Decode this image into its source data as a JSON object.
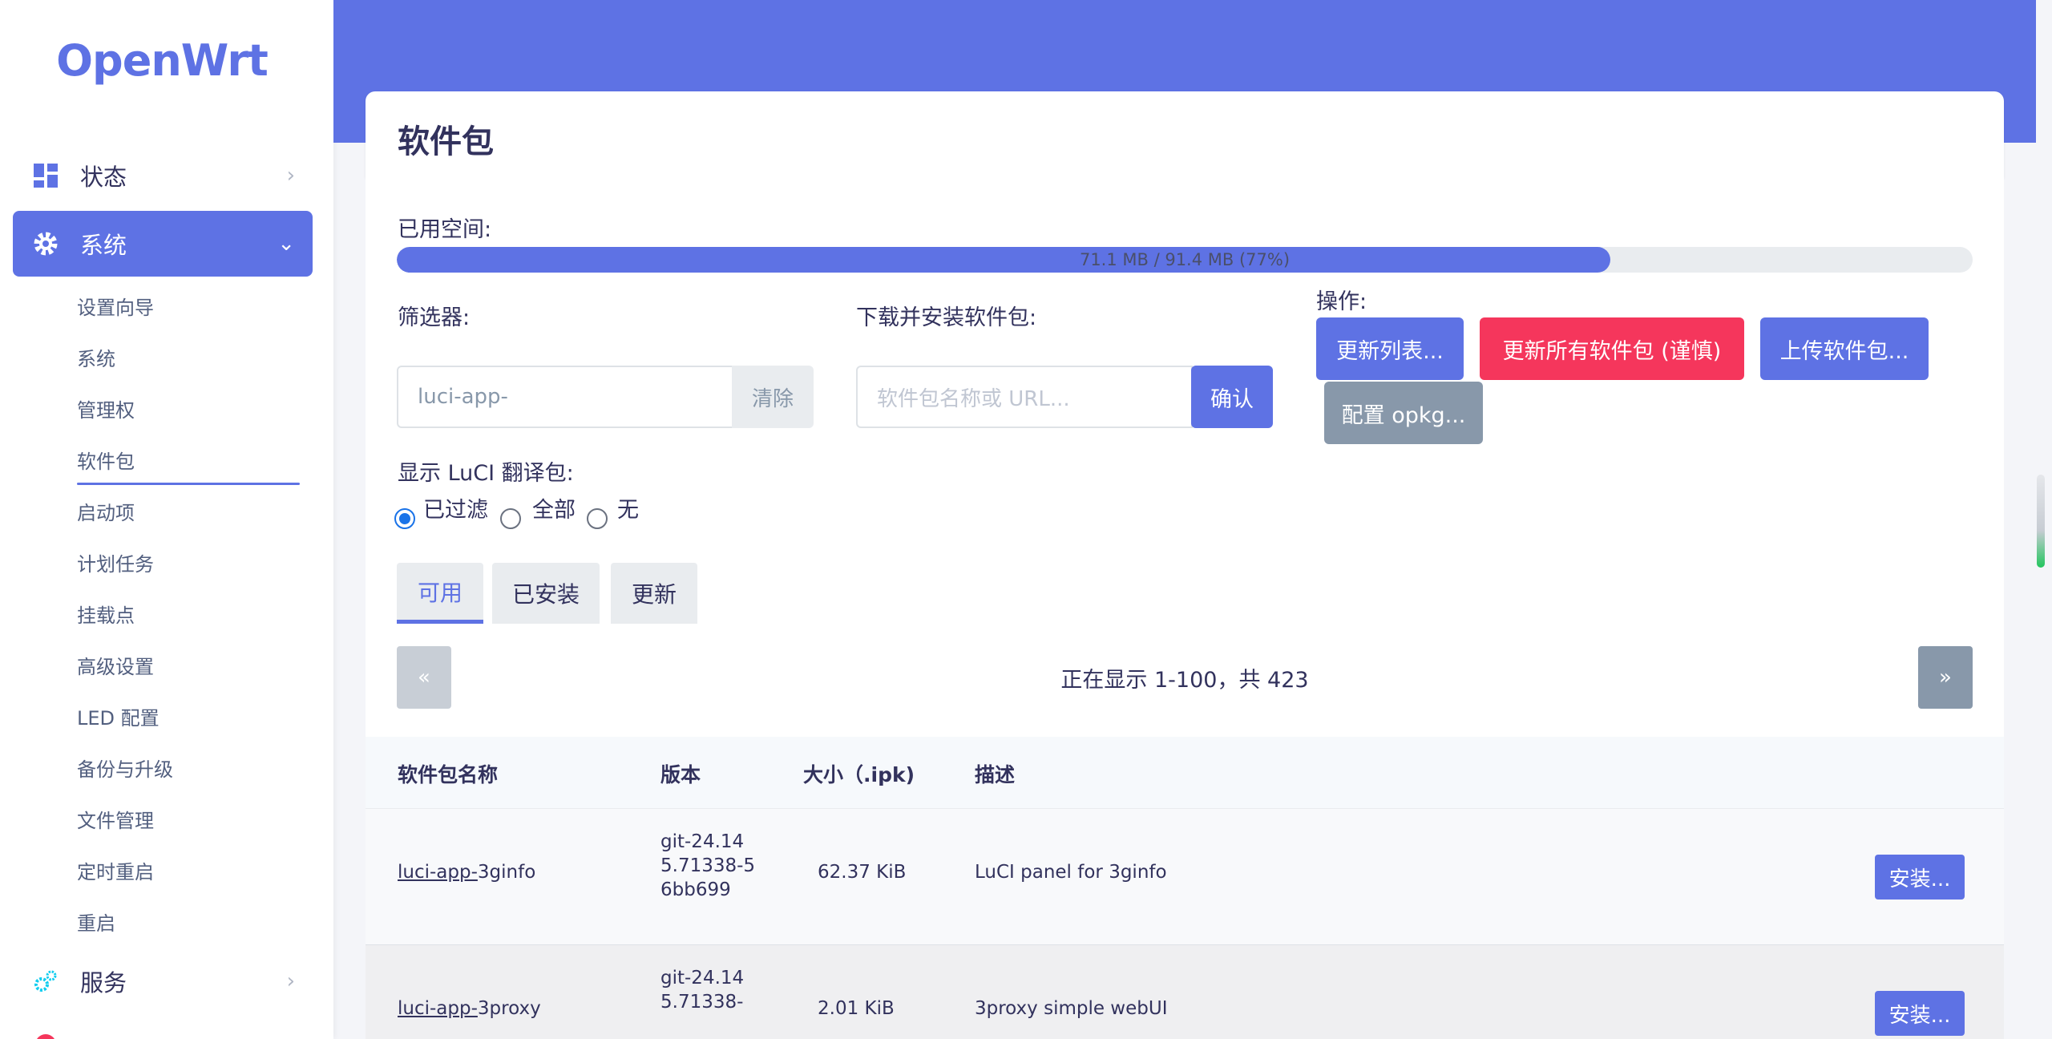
{
  "brand": {
    "logo": "OpenWrt",
    "accent": "#5e72e4"
  },
  "sidebar": {
    "status": "状态",
    "system": "系统",
    "services": "服务",
    "subitems": [
      "设置向导",
      "系统",
      "管理权",
      "软件包",
      "启动项",
      "计划任务",
      "挂载点",
      "高级设置",
      "LED 配置",
      "备份与升级",
      "文件管理",
      "定时重启",
      "重启"
    ],
    "active_subitem": "软件包"
  },
  "page": {
    "title": "软件包"
  },
  "storage": {
    "label": "已用空间:",
    "text": "71.1 MB / 91.4 MB (77%)",
    "percent": 77
  },
  "filter": {
    "label": "筛选器:",
    "value": "luci-app-",
    "clear": "清除"
  },
  "download": {
    "label": "下载并安装软件包:",
    "placeholder": "软件包名称或 URL...",
    "confirm": "确认"
  },
  "actions": {
    "label": "操作:",
    "update_lists": "更新列表...",
    "upgrade_all": "更新所有软件包 (谨慎)",
    "upload": "上传软件包...",
    "configure": "配置 opkg..."
  },
  "translation": {
    "label": "显示 LuCI 翻译包:",
    "options": [
      "已过滤",
      "全部",
      "无"
    ],
    "selected": "已过滤"
  },
  "tabs": [
    "可用",
    "已安装",
    "更新"
  ],
  "active_tab": "可用",
  "pager": {
    "prev": "«",
    "next": "»",
    "info": "正在显示 1-100，共 423"
  },
  "table": {
    "headers": [
      "软件包名称",
      "版本",
      "大小（.ipk)",
      "描述"
    ],
    "rows": [
      {
        "name_prefix": "luci-app-",
        "name_suffix": "3ginfo",
        "version": "git-24.145.71338-56bb699",
        "size": "62.37 KiB",
        "description": "LuCI panel for 3ginfo",
        "action": "安装..."
      },
      {
        "name_prefix": "luci-app-",
        "name_suffix": "3proxy",
        "version": "git-24.145.71338-",
        "size": "2.01 KiB",
        "description": "3proxy simple webUI",
        "action": "安装..."
      }
    ]
  }
}
